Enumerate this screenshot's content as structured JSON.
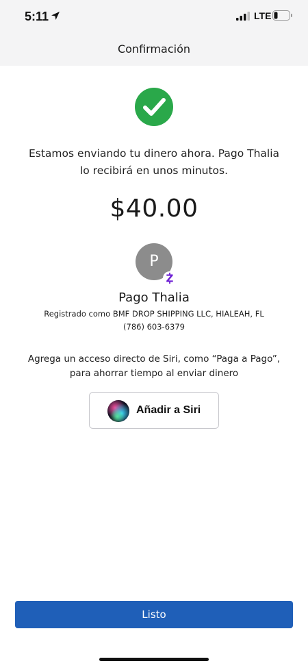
{
  "status_bar": {
    "time": "5:11",
    "network": "LTE"
  },
  "nav": {
    "title": "Confirmación"
  },
  "confirmation": {
    "message": "Estamos enviando tu dinero ahora. Pago Thalia lo recibirá en unos minutos.",
    "amount": "$40.00"
  },
  "recipient": {
    "initial": "P",
    "name": "Pago Thalia",
    "registered": "Registrado como BMF DROP SHIPPING LLC, HIALEAH, FL",
    "phone": "(786) 603-6379"
  },
  "siri": {
    "hint_line1": "Agrega un acceso directo de Siri, como “Paga a Pago”,",
    "hint_line2": "para ahorrar tiempo al enviar dinero",
    "button_label": "Añadir a Siri"
  },
  "actions": {
    "done_label": "Listo"
  },
  "colors": {
    "success_green": "#2aa84a",
    "primary_blue": "#1f5fb8",
    "zelle_purple": "#6d1ed4",
    "avatar_gray": "#8c8c8c"
  },
  "icons": {
    "check": "check-circle-icon",
    "zelle": "zelle-badge-icon",
    "siri": "siri-orb-icon",
    "location": "location-arrow-icon",
    "signal": "signal-icon",
    "battery": "battery-icon"
  }
}
